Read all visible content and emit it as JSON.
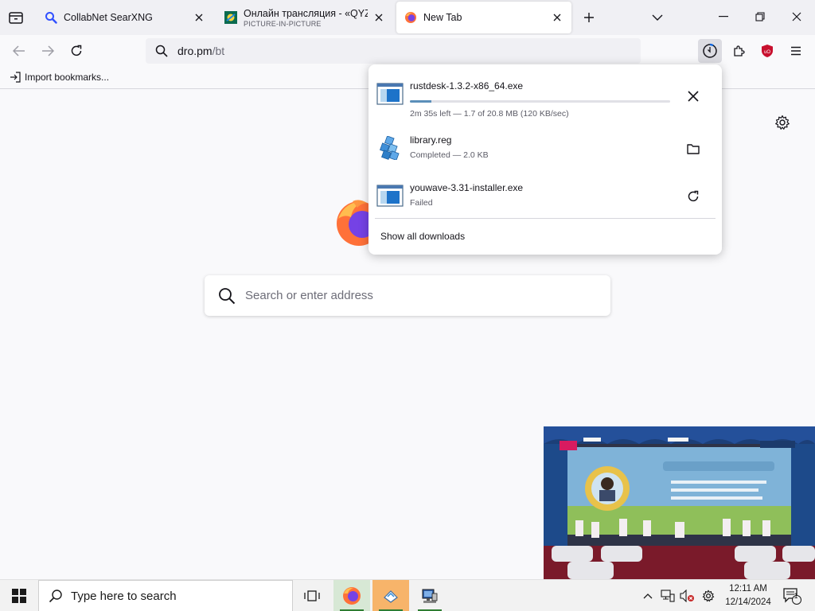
{
  "browser": {
    "tabs": [
      {
        "title": "CollabNet SearXNG",
        "subtitle": "",
        "active": false
      },
      {
        "title": "Онлайн трансляция - «QYZYL",
        "subtitle": "PICTURE-IN-PICTURE",
        "active": false
      },
      {
        "title": "New Tab",
        "subtitle": "",
        "active": true
      }
    ],
    "url": {
      "host": "dro.pm",
      "path": "/bt"
    },
    "bookmarks": [
      {
        "label": "Import bookmarks..."
      }
    ]
  },
  "newtab": {
    "search_placeholder": "Search or enter address"
  },
  "downloads": {
    "items": [
      {
        "name": "rustdesk-1.3.2-x86_64.exe",
        "status": "2m 35s left — 1.7 of 20.8 MB (120 KB/sec)",
        "progress": 0.082,
        "action": "cancel"
      },
      {
        "name": "library.reg",
        "status": "Completed — 2.0 KB",
        "action": "open-folder"
      },
      {
        "name": "youwave-3.31-installer.exe",
        "status": "Failed",
        "action": "retry"
      }
    ],
    "show_all_label": "Show all downloads"
  },
  "taskbar": {
    "search_placeholder": "Type here to search",
    "time": "12:11 AM",
    "date": "12/14/2024",
    "notification_count": "1"
  },
  "colors": {
    "accent_progress": "#5b8fb9",
    "running_indicator": "#2e7d32",
    "ublock_red": "#c8102e"
  }
}
